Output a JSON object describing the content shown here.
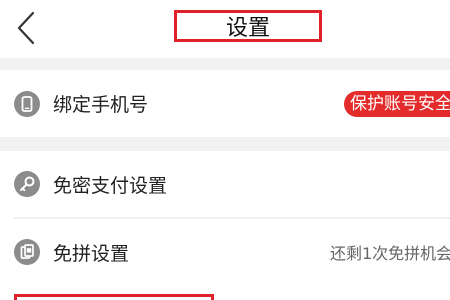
{
  "header": {
    "title": "设置",
    "back_icon": "chevron-left-icon"
  },
  "settings": {
    "items": [
      {
        "icon": "phone-icon",
        "label": "绑定手机号",
        "badge": "保护账号安全"
      },
      {
        "icon": "key-icon",
        "label": "免密支付设置"
      },
      {
        "icon": "pin-free-icon",
        "label": "免拼设置",
        "value": "还剩1次免拼机会"
      }
    ]
  },
  "colors": {
    "accent": "#e0202a",
    "badge": "#e32b2b",
    "icon_gray": "#8c8c8c",
    "separator": "#f2f2f2"
  }
}
